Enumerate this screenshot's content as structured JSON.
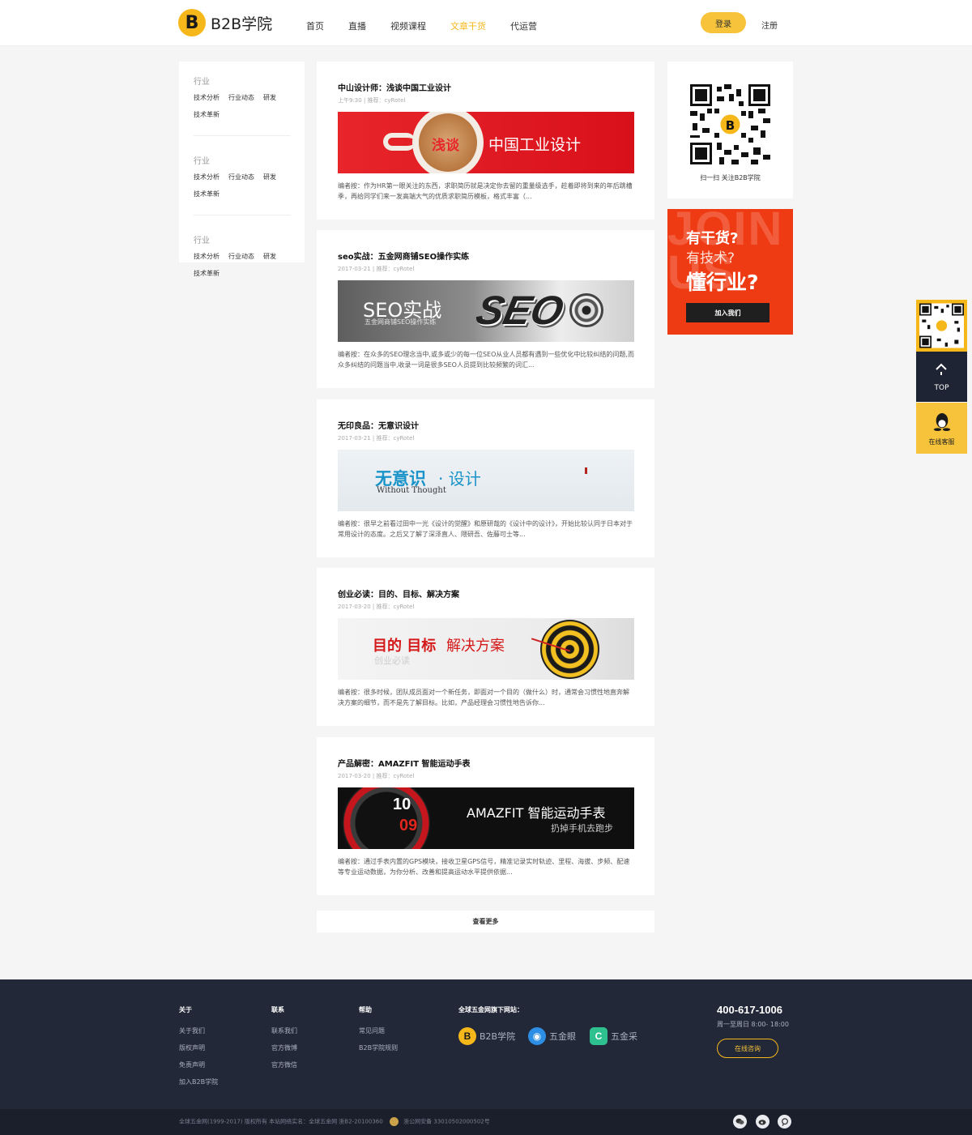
{
  "header": {
    "logo_mark": "B",
    "logo_text": "B2B学院",
    "nav": [
      "首页",
      "直播",
      "视频课程",
      "文章干货",
      "代运营"
    ],
    "active_nav": "文章干货",
    "login": "登录",
    "register": "注册",
    "accent_color": "#f6b71b"
  },
  "sidebar": {
    "groups": [
      {
        "title": "行业",
        "tags": [
          "技术分析",
          "行业动态",
          "研发",
          "技术革新"
        ]
      },
      {
        "title": "行业",
        "tags": [
          "技术分析",
          "行业动态",
          "研发",
          "技术革新"
        ]
      },
      {
        "title": "行业",
        "tags": [
          "技术分析",
          "行业动态",
          "研发",
          "技术革新"
        ]
      }
    ]
  },
  "articles": [
    {
      "title": "中山设计师：浅谈中国工业设计",
      "meta": "上午9:30 | 推荐：cyRotel",
      "banner": {
        "text_a": "浅谈",
        "text_b": "中国工业设计"
      },
      "desc": "编者按：作为HR第一眼关注的东西，求职简历就是决定你去留的重量级选手，趁着即将到来的年后跳槽季，再给同学们来一发高端大气的优质求职简历模板，格式丰富（..."
    },
    {
      "title": "seo实战：五金网商铺SEO操作实练",
      "meta": "2017-03-21 | 推荐：cyRotel",
      "banner": {
        "text_a": "SEO实战",
        "text_b": "五金网商铺SEO操作实练",
        "text_c": "SEO"
      },
      "desc": "编者按：在众多的SEO理念当中,或多或少的每一位SEO从业人员都有遇到一些优化中比较纠结的问题,而众多纠结的问题当中,收录一词是很多SEO人员提到比较频繁的词汇..."
    },
    {
      "title": "无印良品：无意识设计",
      "meta": "2017-03-21 | 推荐：cyRotel",
      "banner": {
        "text_a": "无意识",
        "text_b": "· 设计",
        "text_c": "Without Thought"
      },
      "desc": "编者按：很早之前看过田中一光《设计的觉醒》和原研哉的《设计中的设计》，开始比较认同于日本对于常用设计的态度。之后又了解了深泽直人、隈研吾、佐藤可士等..."
    },
    {
      "title": "创业必读：目的、目标、解决方案",
      "meta": "2017-03-20 | 推荐：cyRotel",
      "banner": {
        "text_a": "目的 目标",
        "text_b": "解决方案",
        "text_c": "创业必读"
      },
      "desc": "编者按：很多时候，团队成员面对一个新任务，即面对一个目的（做什么）时，通常会习惯性地直奔解决方案的细节，而不是先了解目标。比如，产品经理会习惯性地告诉你..."
    },
    {
      "title": "产品解密：AMAZFIT 智能运动手表",
      "meta": "2017-03-20 | 推荐：cyRotel",
      "banner": {
        "text_a": "AMAZFIT 智能运动手表",
        "text_b": "扔掉手机去跑步",
        "text_c": "10",
        "text_d": "09"
      },
      "desc": "编者按：通过手表内置的GPS模块，接收卫星GPS信号，精准记录实时轨迹、里程、海拔、步频、配速等专业运动数据，为你分析、改善和提高运动水平提供依据..."
    }
  ],
  "more": "查看更多",
  "right": {
    "qr_caption": "扫一扫 关注B2B学院",
    "join_bg": "JOIN US",
    "join_l1": "有干货?",
    "join_l2": "有技术?",
    "join_l3": "懂行业?",
    "join_btn": "加入我们"
  },
  "float": {
    "top_label": "TOP",
    "cs_label": "在线客服"
  },
  "footer": {
    "cols": [
      {
        "head": "关于",
        "links": [
          "关于我们",
          "版权声明",
          "免责声明",
          "加入B2B学院"
        ]
      },
      {
        "head": "联系",
        "links": [
          "联系我们",
          "官方微博",
          "官方微信"
        ]
      },
      {
        "head": "帮助",
        "links": [
          "常见问题",
          "B2B学院规则"
        ]
      }
    ],
    "sites_head": "全球五金网旗下网站：",
    "sites": [
      {
        "name": "B2B学院",
        "mark": "B",
        "color": "#f6b71b"
      },
      {
        "name": "五金眼",
        "mark": "◉",
        "color": "#2d8ee6"
      },
      {
        "name": "五金采",
        "mark": "C",
        "color": "#2fc08f"
      }
    ],
    "phone": "400-617-1006",
    "hours": "周一至周日 8:00- 18:00",
    "consult": "在线咨询"
  },
  "bottom": {
    "copy_a": "全球五金网(1999-2017) 版权所有  本站网络实名：全球五金网  浙B2-20100360",
    "copy_b": "浙公网安备 33010502000502号"
  }
}
